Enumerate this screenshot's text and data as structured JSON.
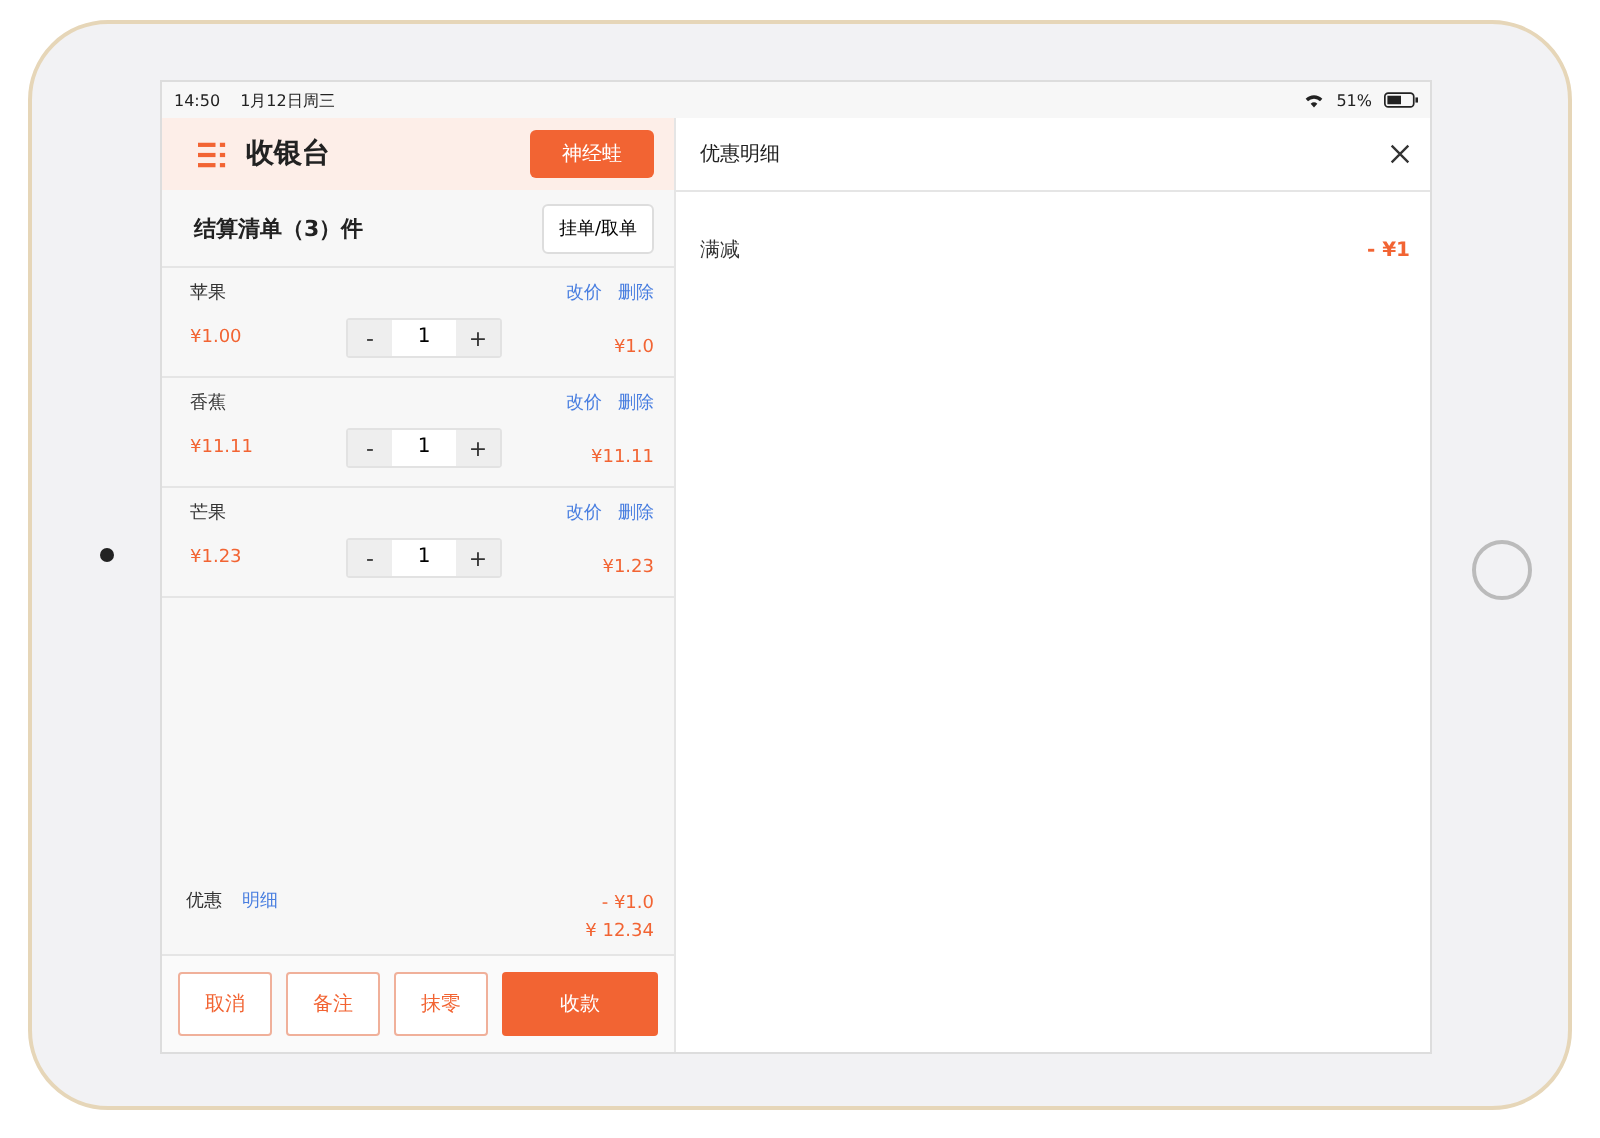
{
  "status_bar": {
    "time": "14:50",
    "date": "1月12日周三",
    "battery": "51%"
  },
  "header": {
    "title": "收银台",
    "user_button": "神经蛙"
  },
  "cart": {
    "title": "结算清单（3）件",
    "hold_button": "挂单/取单",
    "items": [
      {
        "name": "苹果",
        "edit_price": "改价",
        "delete": "删除",
        "unit_price": "¥1.00",
        "minus": "-",
        "quantity": "1",
        "plus": "+",
        "subtotal": "¥1.0"
      },
      {
        "name": "香蕉",
        "edit_price": "改价",
        "delete": "删除",
        "unit_price": "¥11.11",
        "minus": "-",
        "quantity": "1",
        "plus": "+",
        "subtotal": "¥11.11"
      },
      {
        "name": "芒果",
        "edit_price": "改价",
        "delete": "删除",
        "unit_price": "¥1.23",
        "minus": "-",
        "quantity": "1",
        "plus": "+",
        "subtotal": "¥1.23"
      }
    ]
  },
  "summary": {
    "discount_label": "优惠",
    "detail_link": "明细",
    "discount": "- ¥1.0",
    "total": "¥ 12.34"
  },
  "actions": [
    {
      "label": "取消",
      "kind": "outline"
    },
    {
      "label": "备注",
      "kind": "outline"
    },
    {
      "label": "抹零",
      "kind": "outline"
    },
    {
      "label": "收款",
      "kind": "primary"
    }
  ],
  "detail_panel": {
    "title": "优惠明细",
    "rows": [
      {
        "label": "满减",
        "value": "- ¥1"
      }
    ]
  }
}
